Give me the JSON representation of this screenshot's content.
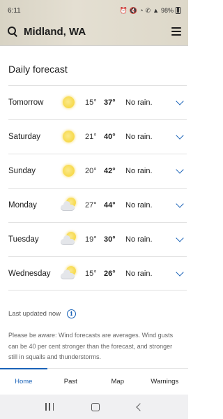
{
  "status_bar": {
    "time": "6:11",
    "battery": "98%",
    "icons": [
      "alarm-icon",
      "mute-icon",
      "wifi-icon",
      "call-icon",
      "signal-icon",
      "battery-icon"
    ]
  },
  "header": {
    "location": "Midland, WA"
  },
  "page_title": "Daily forecast",
  "forecast": [
    {
      "day": "Tomorrow",
      "icon": "sunny-icon",
      "min": "15°",
      "max": "37°",
      "summary": "No rain."
    },
    {
      "day": "Saturday",
      "icon": "sunny-icon",
      "min": "21°",
      "max": "40°",
      "summary": "No rain."
    },
    {
      "day": "Sunday",
      "icon": "sunny-icon",
      "min": "20°",
      "max": "42°",
      "summary": "No rain."
    },
    {
      "day": "Monday",
      "icon": "partly-cloudy-icon",
      "min": "27°",
      "max": "44°",
      "summary": "No rain."
    },
    {
      "day": "Tuesday",
      "icon": "partly-cloudy-icon",
      "min": "19°",
      "max": "30°",
      "summary": "No rain."
    },
    {
      "day": "Wednesday",
      "icon": "partly-cloudy-icon",
      "min": "15°",
      "max": "26°",
      "summary": "No rain."
    }
  ],
  "last_updated": "Last updated now",
  "notice": "Please be aware: Wind forecasts are averages. Wind gusts can be 40 per cent stronger than the forecast, and stronger still in squalls and thunderstorms.",
  "bottom_nav": [
    {
      "label": "Home",
      "active": true
    },
    {
      "label": "Past",
      "active": false
    },
    {
      "label": "Map",
      "active": false
    },
    {
      "label": "Warnings",
      "active": false
    }
  ],
  "colors": {
    "accent": "#1a63b8",
    "sun": "#f7d94a"
  }
}
